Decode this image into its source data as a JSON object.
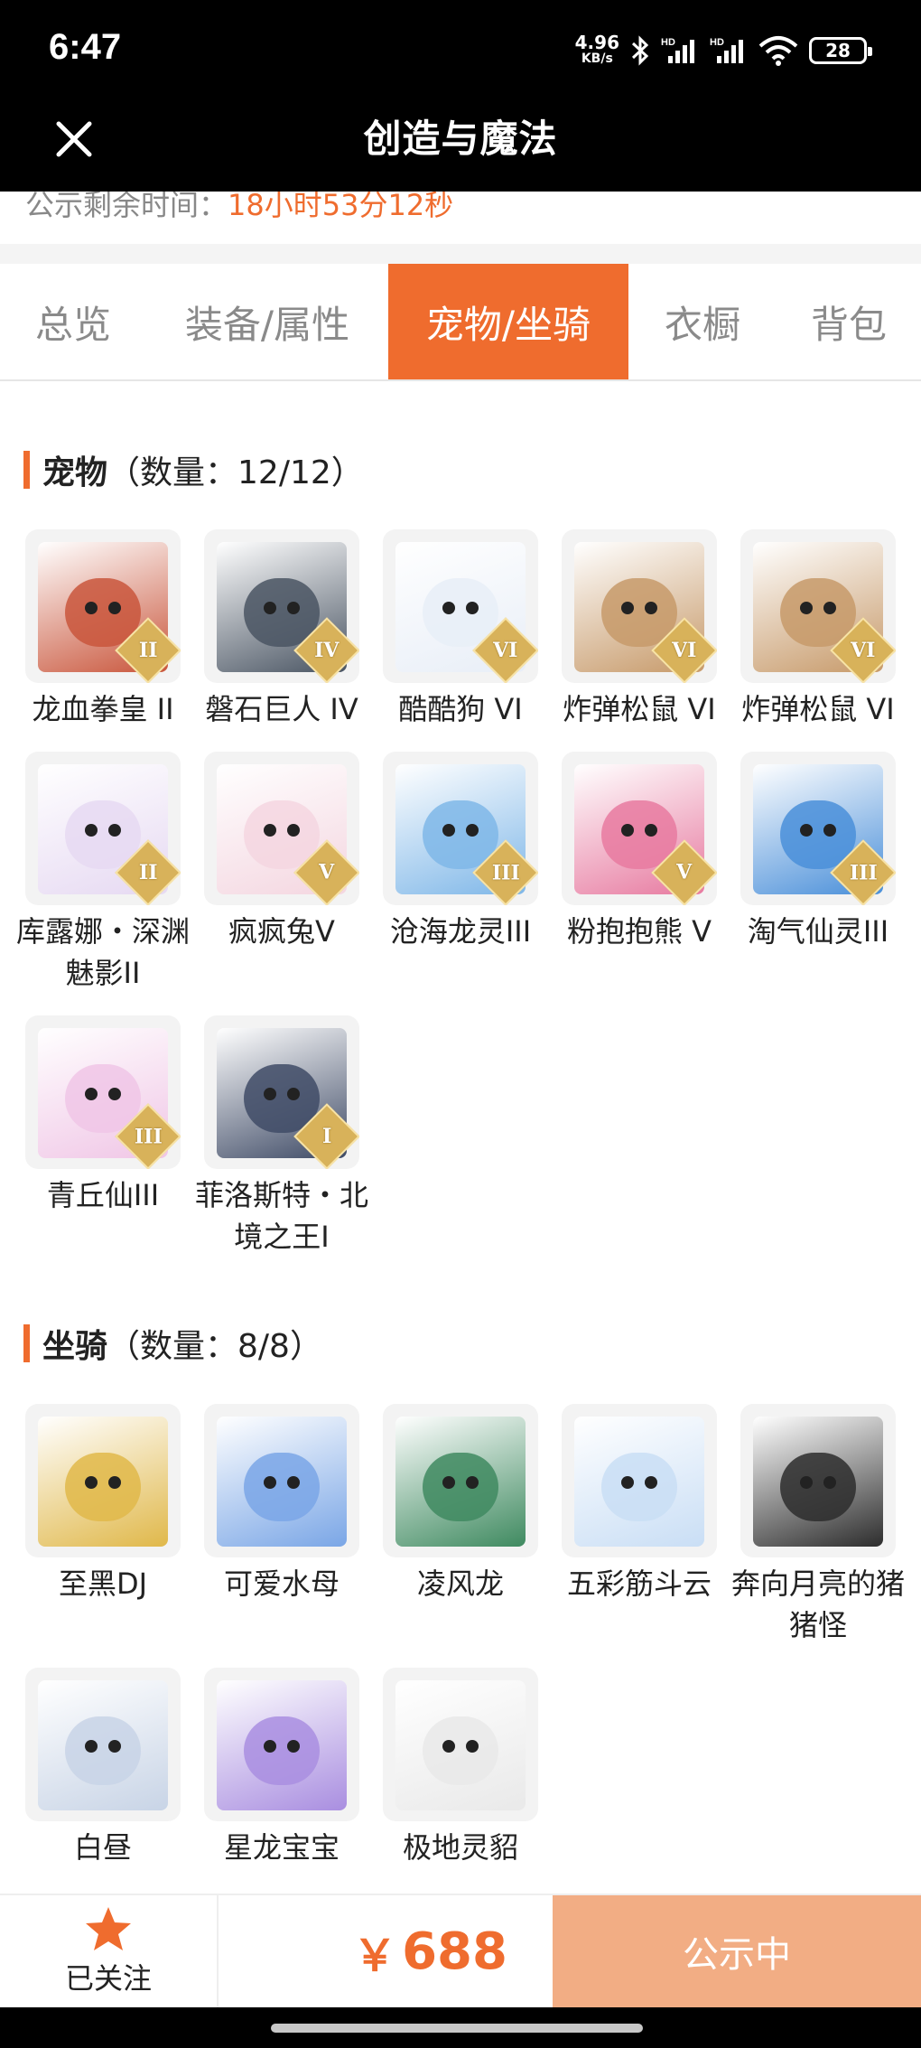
{
  "status_bar": {
    "time": "6:47",
    "speed_value": "4.96",
    "speed_unit": "KB/s",
    "battery": "28"
  },
  "header": {
    "title": "创造与魔法"
  },
  "countdown": {
    "label": "公示剩余时间：",
    "value": "18小时53分12秒"
  },
  "tabs": [
    {
      "label": "总览",
      "active": false
    },
    {
      "label": "装备/属性",
      "active": false
    },
    {
      "label": "宠物/坐骑",
      "active": true
    },
    {
      "label": "衣橱",
      "active": false
    },
    {
      "label": "背包",
      "active": false
    }
  ],
  "pets": {
    "title": "宠物",
    "count_text": "（数量：12/12）",
    "items": [
      {
        "name": "龙血拳皇 II",
        "badge": "II",
        "color": "#c9563c"
      },
      {
        "name": "磐石巨人 IV",
        "badge": "IV",
        "color": "#4a5563"
      },
      {
        "name": "酷酷狗 VI",
        "badge": "VI",
        "color": "#e8eef7"
      },
      {
        "name": "炸弹松鼠 VI",
        "badge": "VI",
        "color": "#c79a6a"
      },
      {
        "name": "炸弹松鼠 VI",
        "badge": "VI",
        "color": "#c79a6a"
      },
      {
        "name": "库露娜・深渊魅影II",
        "badge": "II",
        "color": "#e6d9f2"
      },
      {
        "name": "疯疯兔V",
        "badge": "V",
        "color": "#f4d6e0"
      },
      {
        "name": "沧海龙灵III",
        "badge": "III",
        "color": "#7fb7e8"
      },
      {
        "name": "粉抱抱熊 V",
        "badge": "V",
        "color": "#e77aa0"
      },
      {
        "name": "淘气仙灵III",
        "badge": "III",
        "color": "#4a8fd9"
      },
      {
        "name": "青丘仙III",
        "badge": "III",
        "color": "#f0c6e6"
      },
      {
        "name": "菲洛斯特・北境之王I",
        "badge": "I",
        "color": "#3f4b66"
      }
    ]
  },
  "mounts": {
    "title": "坐骑",
    "count_text": "（数量：8/8）",
    "items": [
      {
        "name": "至黑DJ",
        "color": "#e0b84a"
      },
      {
        "name": "可爱水母",
        "color": "#7aa6e6"
      },
      {
        "name": "凌风龙",
        "color": "#3f8a60"
      },
      {
        "name": "五彩筋斗云",
        "color": "#c9def5"
      },
      {
        "name": "奔向月亮的猪猪怪",
        "color": "#2d2d2d"
      },
      {
        "name": "白昼",
        "color": "#c8d4e6"
      },
      {
        "name": "星龙宝宝",
        "color": "#a98ee0"
      },
      {
        "name": "极地灵貂",
        "color": "#e9e9e9"
      }
    ]
  },
  "bottom": {
    "follow_label": "已关注",
    "currency": "￥",
    "price": "688",
    "status_label": "公示中"
  },
  "colors": {
    "accent": "#ef6c2e",
    "status_button": "#f2ad84"
  }
}
